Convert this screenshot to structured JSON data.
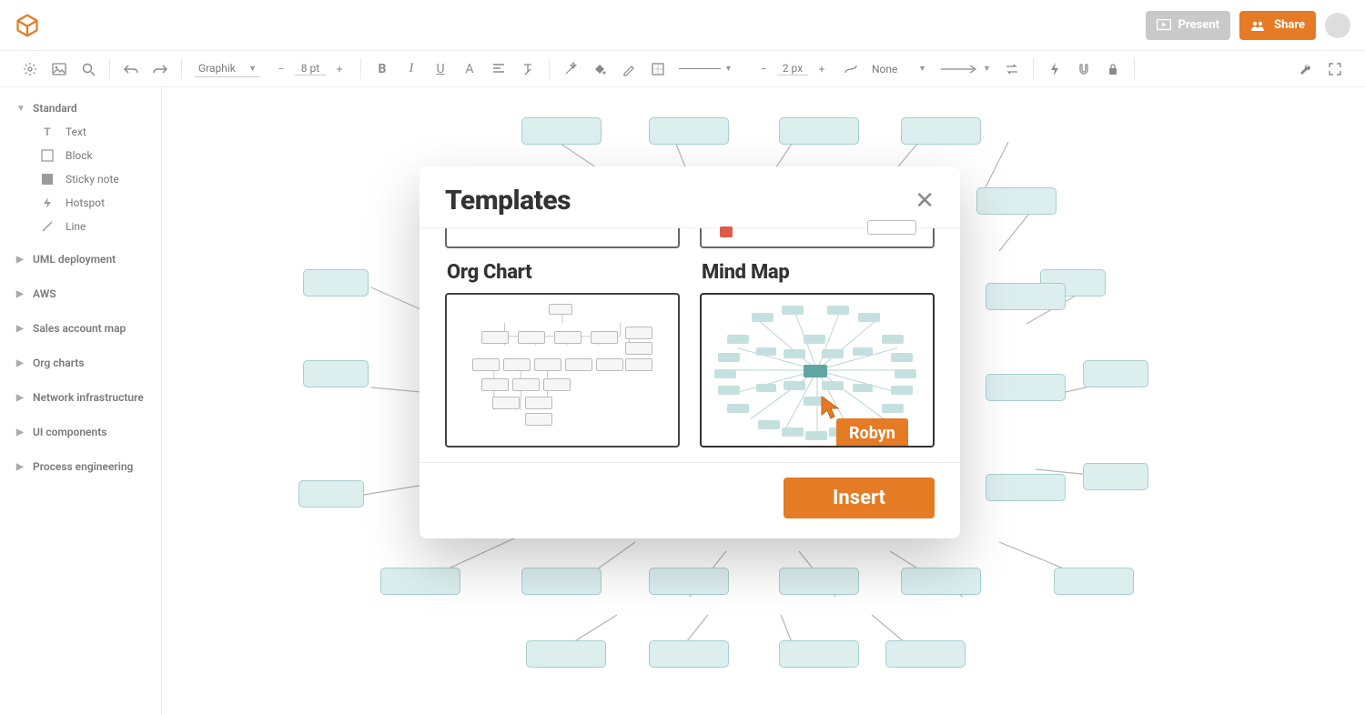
{
  "header": {
    "present": "Present",
    "share": "Share"
  },
  "toolbar": {
    "font": "Graphik",
    "font_size": "8 pt",
    "line_width": "2 px",
    "line_end": "None"
  },
  "sidebar": {
    "standard_label": "Standard",
    "standard_items": [
      "Text",
      "Block",
      "Sticky note",
      "Hotspot",
      "Line"
    ],
    "groups": [
      "UML deployment",
      "AWS",
      "Sales account map",
      "Org charts",
      "Network infrastructure",
      "UI components",
      "Process engineering"
    ]
  },
  "modal": {
    "title": "Templates",
    "template1": "Org Chart",
    "template2": "Mind Map",
    "insert": "Insert",
    "user_tag": "Robyn"
  }
}
